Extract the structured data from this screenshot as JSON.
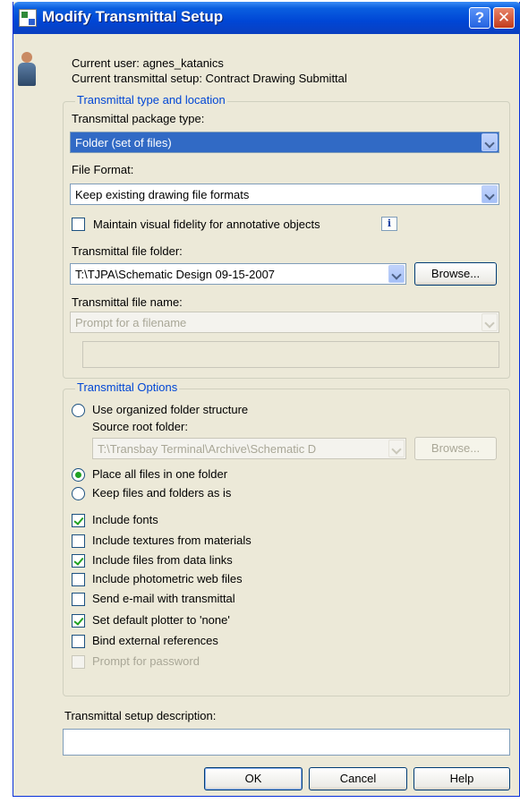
{
  "window": {
    "title": "Modify Transmittal Setup",
    "help_glyph": "?",
    "close_glyph": "✕"
  },
  "header": {
    "current_user": "Current user: agnes_katanics",
    "current_setup": "Current transmittal setup: Contract Drawing Submittal"
  },
  "type_location": {
    "group_title": "Transmittal type and location",
    "package_type_label": "Transmittal package type:",
    "package_type_value": "Folder (set of files)",
    "file_format_label": "File Format:",
    "file_format_value": "Keep existing drawing file formats",
    "visual_fidelity_label": "Maintain visual fidelity for annotative objects",
    "visual_fidelity_checked": false,
    "info_glyph": "i",
    "file_folder_label": "Transmittal file folder:",
    "file_folder_value": "T:\\TJPA\\Schematic Design 09-15-2007",
    "browse_label": "Browse...",
    "file_name_label": "Transmittal file name:",
    "file_name_value": "Prompt for a filename",
    "file_name_text": ""
  },
  "options": {
    "group_title": "Transmittal Options",
    "radio_organized": "Use organized folder structure",
    "source_root_label": "Source root folder:",
    "source_root_value": "T:\\Transbay Terminal\\Archive\\Schematic D",
    "browse_label": "Browse...",
    "radio_one_folder": "Place all files in one folder",
    "radio_keep": "Keep files and folders as is",
    "selected_radio": "Place all files in one folder",
    "checkboxes": [
      {
        "label": "Include fonts",
        "checked": true,
        "enabled": true
      },
      {
        "label": "Include textures from materials",
        "checked": false,
        "enabled": true
      },
      {
        "label": "Include files from data links",
        "checked": true,
        "enabled": true
      },
      {
        "label": "Include photometric web files",
        "checked": false,
        "enabled": true
      },
      {
        "label": "Send e-mail with transmittal",
        "checked": false,
        "enabled": true
      },
      {
        "label": "Set default plotter to 'none'",
        "checked": true,
        "enabled": true
      },
      {
        "label": "Bind external references",
        "checked": false,
        "enabled": true
      },
      {
        "label": "Prompt for password",
        "checked": false,
        "enabled": false
      }
    ]
  },
  "description": {
    "label": "Transmittal setup description:",
    "value": ""
  },
  "footer": {
    "ok_label": "OK",
    "cancel_label": "Cancel",
    "help_label": "Help"
  },
  "colors": {
    "title_bar": "#0046d5",
    "group_title": "#0046d5",
    "selection": "#316ac5",
    "check_mark": "#21a121"
  }
}
